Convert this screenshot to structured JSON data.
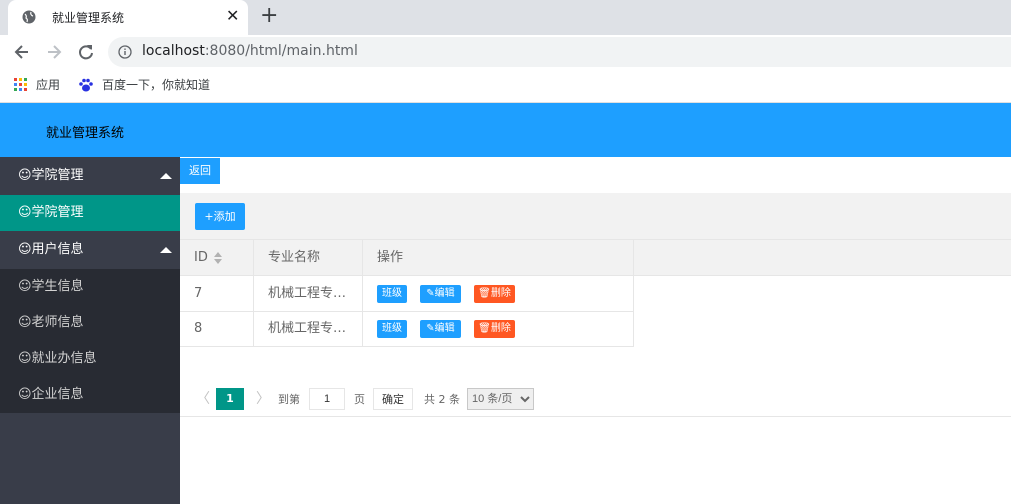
{
  "browser": {
    "tab_title": "就业管理系统",
    "tab_close": "✕",
    "new_tab": "+",
    "url_host": "localhost",
    "url_rest": ":8080/html/main.html",
    "bookmarks": [
      {
        "label": "应用"
      },
      {
        "label": "百度一下，你就知道"
      }
    ]
  },
  "app": {
    "title": "就业管理系统",
    "accent_color": "#1e9fff",
    "active_color": "#009688",
    "danger_color": "#ff5722"
  },
  "sidebar": {
    "group1": {
      "label": "☺学院管理"
    },
    "group1_items": [
      {
        "label": "☺学院管理"
      }
    ],
    "group2": {
      "label": "☺用户信息"
    },
    "group2_items": [
      {
        "label": "☺学生信息"
      },
      {
        "label": "☺老师信息"
      },
      {
        "label": "☺就业办信息"
      },
      {
        "label": "☺企业信息"
      }
    ]
  },
  "main": {
    "back_label": "返回",
    "add_label": "+添加",
    "table": {
      "headers": [
        "ID",
        "专业名称",
        "操作"
      ],
      "rows": [
        {
          "id": "7",
          "name": "机械工程专…"
        },
        {
          "id": "8",
          "name": "机械工程专…"
        }
      ],
      "actions": {
        "classes": "班级",
        "edit": "✎编辑",
        "delete": "🗑删除"
      }
    },
    "pager": {
      "prev": "〈",
      "current": "1",
      "next": "〉",
      "goto_label": "到第",
      "page_value": "1",
      "page_unit": "页",
      "confirm": "确定",
      "total": "共 2 条",
      "page_size": "10 条/页"
    }
  }
}
